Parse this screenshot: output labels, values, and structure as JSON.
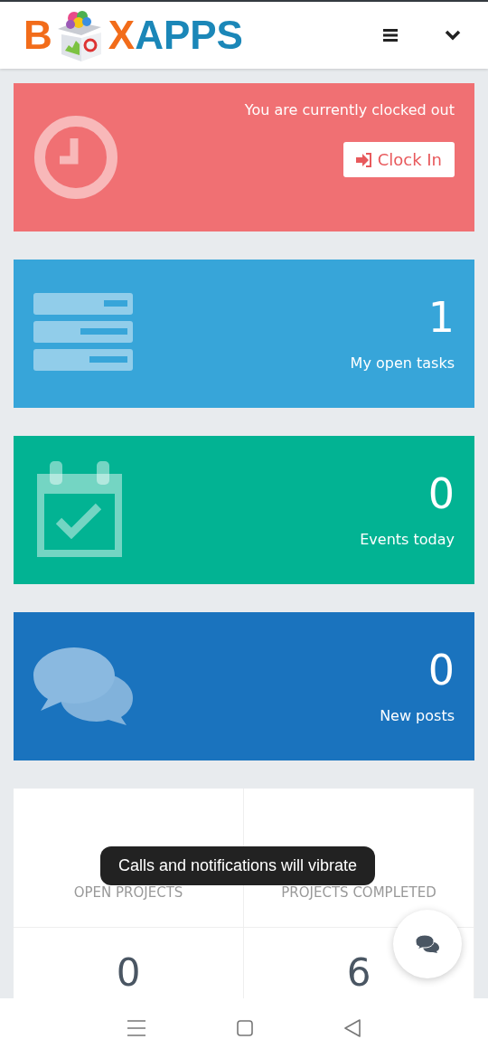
{
  "header": {
    "logo_first": "B",
    "logo_rest": "XAPPS"
  },
  "clock_card": {
    "status": "You are currently clocked out",
    "button": "Clock In"
  },
  "stat_cards": [
    {
      "kind": "tasks",
      "count": "1",
      "label": "My open tasks",
      "color": "#37a5d9"
    },
    {
      "kind": "events",
      "count": "0",
      "label": "Events today",
      "color": "#02b393"
    },
    {
      "kind": "posts",
      "count": "0",
      "label": "New posts",
      "color": "#1a73be"
    }
  ],
  "project_stats": [
    {
      "label": "OPEN PROJECTS"
    },
    {
      "label": "PROJECTS COMPLETED"
    },
    {
      "value": "0"
    },
    {
      "value": "6"
    }
  ],
  "toast": "Calls and notifications will vibrate"
}
